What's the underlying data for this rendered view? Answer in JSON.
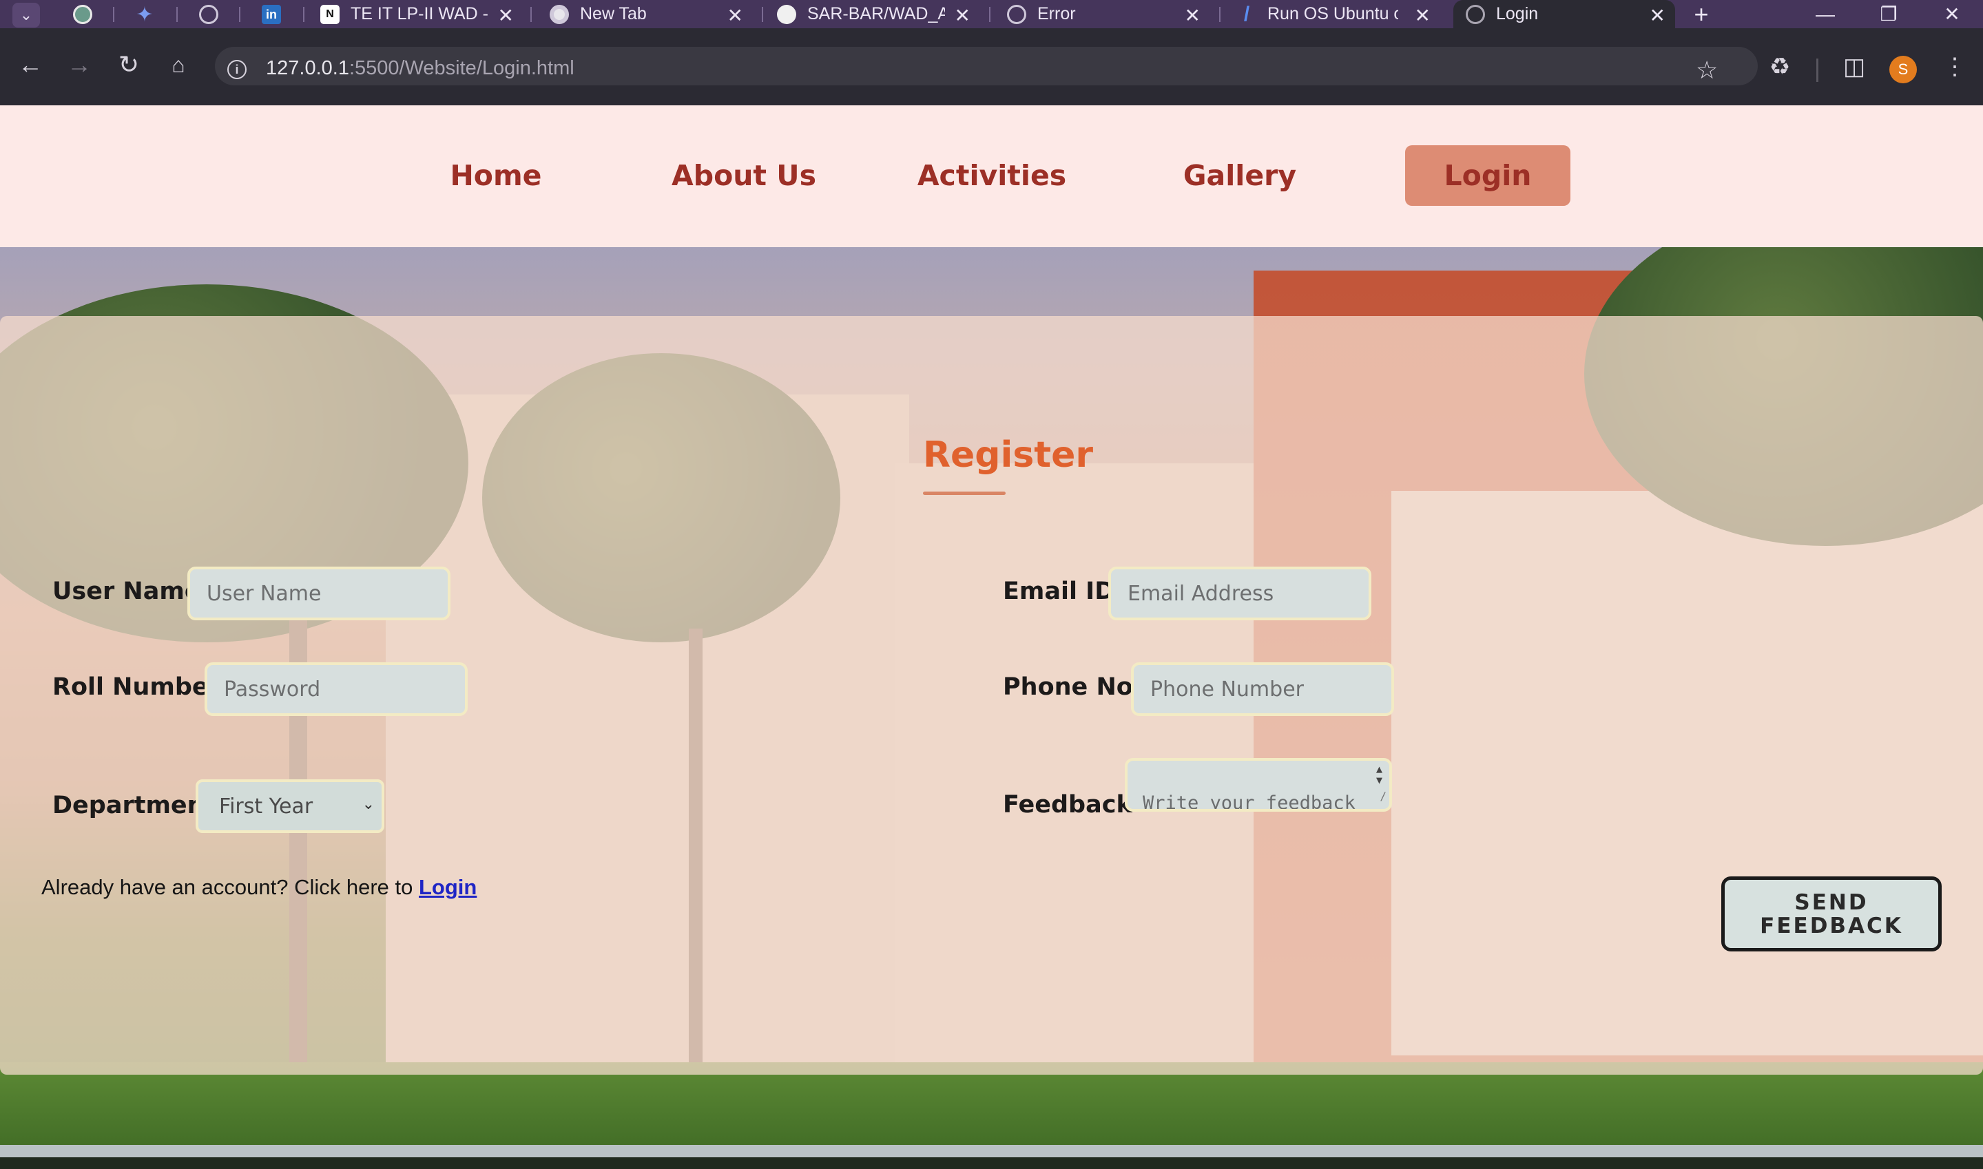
{
  "browser": {
    "tabs": [
      {
        "label": "TE IT LP-II WAD - ",
        "favicon": "notion-icon"
      },
      {
        "label": "New Tab",
        "favicon": "chrome-icon"
      },
      {
        "label": "SAR-BAR/WAD_A",
        "favicon": "github-icon"
      },
      {
        "label": "Error",
        "favicon": "globe-icon"
      },
      {
        "label": "Run OS Ubuntu o",
        "favicon": "replit-icon"
      },
      {
        "label": "Login",
        "favicon": "globe-icon",
        "active": true
      }
    ],
    "pinned_tabs": [
      "chatgpt-icon",
      "gemini-icon",
      "globe-icon",
      "linkedin-icon"
    ],
    "url_host": "127.0.0.1",
    "url_path": ":5500/Website/Login.html",
    "profile_initial": "S",
    "profile_color": "#e37c1e",
    "tab_bar_color": "#45355b"
  },
  "nav": {
    "items": [
      {
        "label": "Home"
      },
      {
        "label": "About Us"
      },
      {
        "label": "Activities"
      },
      {
        "label": "Gallery"
      },
      {
        "label": "Login",
        "active": true
      }
    ],
    "text_color": "#9c2f26",
    "background": "#fde9e7",
    "active_background": "#dd8c74"
  },
  "form": {
    "title": "Register",
    "title_color": "#e0612d",
    "username": {
      "label": "User Name",
      "placeholder": "User Name"
    },
    "rollno": {
      "label": "Roll Number",
      "placeholder": "Password"
    },
    "department": {
      "label": "Department",
      "selected": "First Year"
    },
    "email": {
      "label": "Email ID",
      "placeholder": "Email Address"
    },
    "phone": {
      "label": "Phone No.",
      "placeholder": "Phone Number"
    },
    "feedback": {
      "label": "Feedback",
      "placeholder": "Write your feedback here"
    },
    "already_text": "Already have an account? Click here to",
    "already_link": "Login",
    "send_button": "SEND FEEDBACK"
  }
}
